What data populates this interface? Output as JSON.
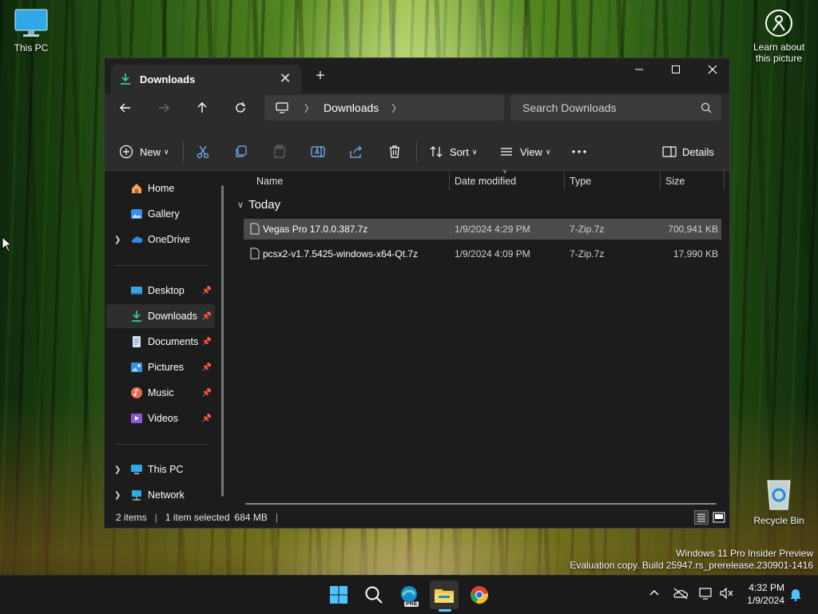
{
  "desktop": {
    "this_pc_label": "This PC",
    "learn_label_1": "Learn about",
    "learn_label_2": "this picture",
    "recycle_bin_label": "Recycle Bin",
    "watermark_line1": "Windows 11 Pro Insider Preview",
    "watermark_line2": "Evaluation copy. Build 25947.rs_prerelease.230901-1416"
  },
  "window": {
    "tab_title": "Downloads",
    "address": {
      "segment": "Downloads"
    },
    "search_placeholder": "Search Downloads",
    "toolbar": {
      "new_label": "New",
      "sort_label": "Sort",
      "view_label": "View",
      "details_label": "Details"
    },
    "sidebar": {
      "items": [
        {
          "label": "Home",
          "icon": "home-icon"
        },
        {
          "label": "Gallery",
          "icon": "gallery-icon"
        },
        {
          "label": "OneDrive",
          "icon": "onedrive-icon"
        },
        {
          "label": "Desktop",
          "icon": "desktop-folder-icon",
          "pinned": true
        },
        {
          "label": "Downloads",
          "icon": "download-icon",
          "pinned": true,
          "selected": true
        },
        {
          "label": "Documents",
          "icon": "documents-icon",
          "pinned": true
        },
        {
          "label": "Pictures",
          "icon": "pictures-icon",
          "pinned": true
        },
        {
          "label": "Music",
          "icon": "music-icon",
          "pinned": true
        },
        {
          "label": "Videos",
          "icon": "videos-icon",
          "pinned": true
        },
        {
          "label": "This PC",
          "icon": "computer-icon"
        },
        {
          "label": "Network",
          "icon": "network-icon"
        }
      ]
    },
    "columns": {
      "name": "Name",
      "date": "Date modified",
      "type": "Type",
      "size": "Size"
    },
    "group_label": "Today",
    "files": [
      {
        "name": "Vegas Pro 17.0.0.387.7z",
        "date": "1/9/2024 4:29 PM",
        "type": "7-Zip.7z",
        "size": "700,941 KB",
        "selected": true
      },
      {
        "name": "pcsx2-v1.7.5425-windows-x64-Qt.7z",
        "date": "1/9/2024 4:09 PM",
        "type": "7-Zip.7z",
        "size": "17,990 KB",
        "selected": false
      }
    ],
    "status": {
      "items": "2 items",
      "selection": "1 item selected",
      "size": "684 MB"
    }
  },
  "taskbar": {
    "time": "4:32 PM",
    "date": "1/9/2024",
    "apps": [
      "windows-start-icon",
      "search-icon",
      "edge-preview-icon",
      "file-explorer-icon",
      "chrome-icon"
    ],
    "edge_badge": "PRE"
  },
  "colors": {
    "accent": "#60cdff",
    "window_bg": "#1c1c1c",
    "chrome_bg": "#2c2c2c",
    "selection": "#4b4b4b"
  }
}
